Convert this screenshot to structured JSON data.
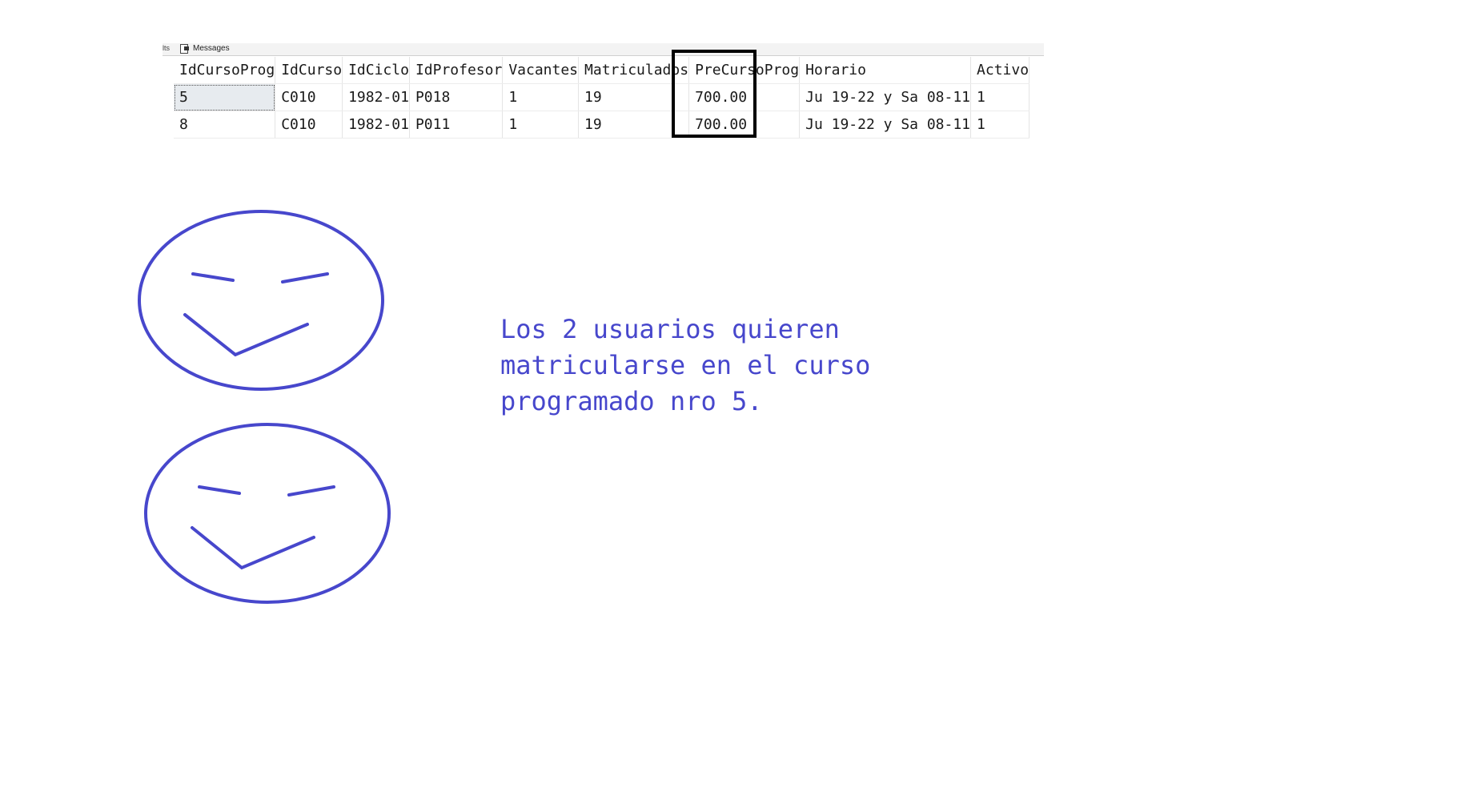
{
  "tabs": {
    "cut_label": "lts",
    "messages_label": "Messages",
    "messages_icon": "document-icon"
  },
  "table": {
    "columns": [
      "IdCursoProg",
      "IdCurso",
      "IdCiclo",
      "IdProfesor",
      "Vacantes",
      "Matriculados",
      "PreCursoProg",
      "Horario",
      "Activo"
    ],
    "rows": [
      [
        "5",
        "C010",
        "1982-01",
        "P018",
        "1",
        "19",
        "700.00",
        "Ju 19-22 y Sa 08-11",
        "1"
      ],
      [
        "8",
        "C010",
        "1982-01",
        "P011",
        "1",
        "19",
        "700.00",
        "Ju 19-22 y Sa 08-11",
        "1"
      ]
    ],
    "highlighted_column": "Vacantes",
    "selected_cell": "5"
  },
  "annotation": {
    "lines": [
      "Los 2 usuarios quieren",
      "matricularse en el curso",
      "programado nro 5."
    ]
  },
  "colors": {
    "ink": "#4747cc",
    "highlight_border": "#000000",
    "selected_cell_bg": "#e7ebef"
  }
}
